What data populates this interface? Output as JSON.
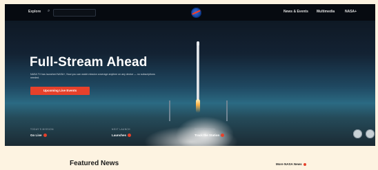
{
  "header": {
    "explore_label": "Explore",
    "search_placeholder": "",
    "nav": [
      "News & Events",
      "Multimedia",
      "NASA+"
    ]
  },
  "hero": {
    "title": "Full-Stream Ahead",
    "description": "NASA TV has launched NASA+, Now you can watch mission coverage anytime on any device — no subscriptions needed.",
    "button_label": "Upcoming Live Events"
  },
  "stats": [
    {
      "label": "TODAY'S MISSION",
      "value": "Go Live"
    },
    {
      "label": "NEXT LAUNCH",
      "value": "Launches"
    },
    {
      "label": "SPACE STATION",
      "value": "Track the Station"
    }
  ],
  "featured": {
    "title": "Featured News",
    "more_label": "More NASA News"
  },
  "colors": {
    "accent": "#e6412b",
    "nav_bg": "#060a10",
    "page_bg": "#fdf3e1"
  }
}
